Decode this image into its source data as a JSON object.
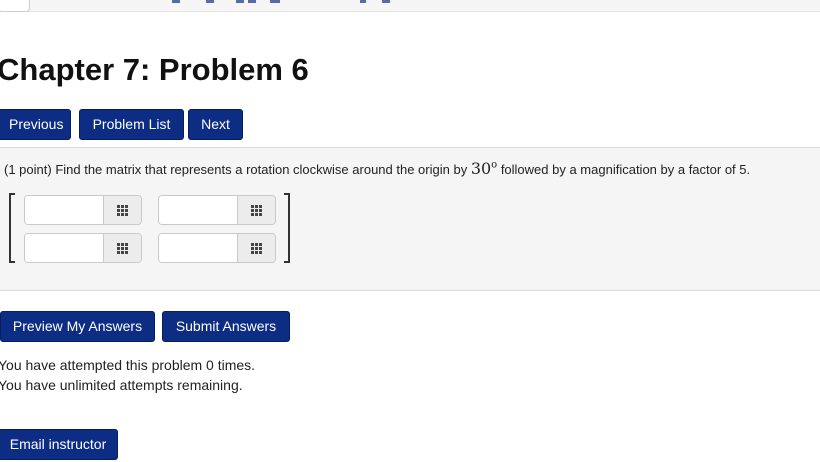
{
  "header": {
    "title": "Chapter 7: Problem 6"
  },
  "nav": {
    "previous_label": "Previous",
    "problem_list_label": "Problem List",
    "next_label": "Next"
  },
  "problem": {
    "points": "(1 point)",
    "text_before": " Find the matrix that represents a rotation clockwise around the origin by ",
    "angle": "30",
    "angle_unit": "o",
    "text_after": " followed by a magnification by a factor of 5.",
    "matrix": {
      "cells": [
        {
          "value": "",
          "icon": "grid-icon"
        },
        {
          "value": "",
          "icon": "grid-icon"
        },
        {
          "value": "",
          "icon": "grid-icon"
        },
        {
          "value": "",
          "icon": "grid-icon"
        }
      ]
    }
  },
  "actions": {
    "preview_label": "Preview My Answers",
    "submit_label": "Submit Answers"
  },
  "status": {
    "attempts_line": "You have attempted this problem 0 times.",
    "remaining_line": "You have unlimited attempts remaining."
  },
  "footer": {
    "email_label": "Email instructor"
  },
  "colors": {
    "button_bg": "#0d2d84",
    "problem_bg": "#f5f5f5"
  }
}
